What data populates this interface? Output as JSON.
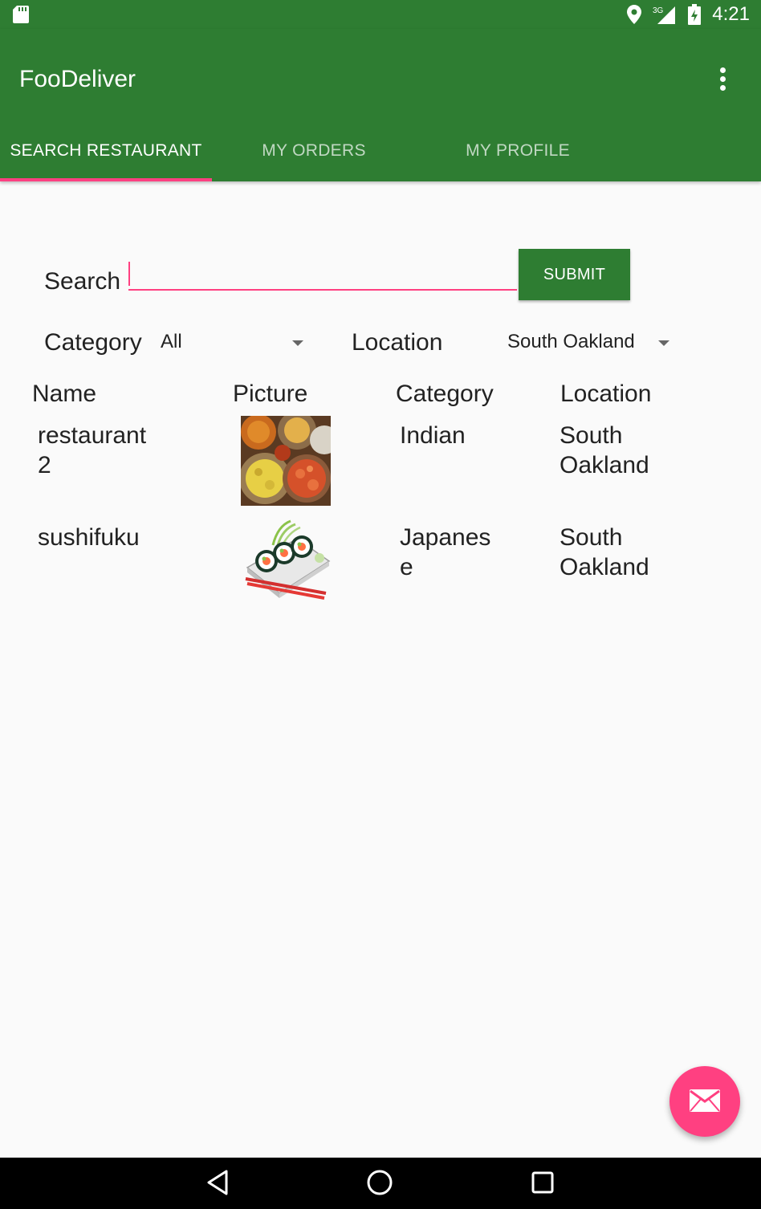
{
  "status_bar": {
    "time": "4:21",
    "network": "3G"
  },
  "app": {
    "title": "FooDeliver"
  },
  "tabs": [
    {
      "label": "SEARCH RESTAURANT",
      "active": true
    },
    {
      "label": "MY ORDERS",
      "active": false
    },
    {
      "label": "MY PROFILE",
      "active": false
    }
  ],
  "search": {
    "label": "Search",
    "value": "",
    "submit_label": "SUBMIT"
  },
  "filters": {
    "category_label": "Category",
    "category_value": "All",
    "location_label": "Location",
    "location_value": "South Oakland"
  },
  "table": {
    "headers": [
      "Name",
      "Picture",
      "Category",
      "Location"
    ],
    "rows": [
      {
        "name_line1": "restaurant",
        "name_line2": "2",
        "picture": "indian-food-image",
        "category_line1": "Indian",
        "category_line2": "",
        "location_line1": "South",
        "location_line2": "Oakland"
      },
      {
        "name_line1": "sushifuku",
        "name_line2": "",
        "picture": "sushi-image",
        "category_line1": "Japanes",
        "category_line2": "e",
        "location_line1": "South",
        "location_line2": "Oakland"
      }
    ]
  },
  "fab": {
    "icon": "mail-icon"
  },
  "colors": {
    "primary": "#2e7d32",
    "accent": "#ff4081"
  }
}
